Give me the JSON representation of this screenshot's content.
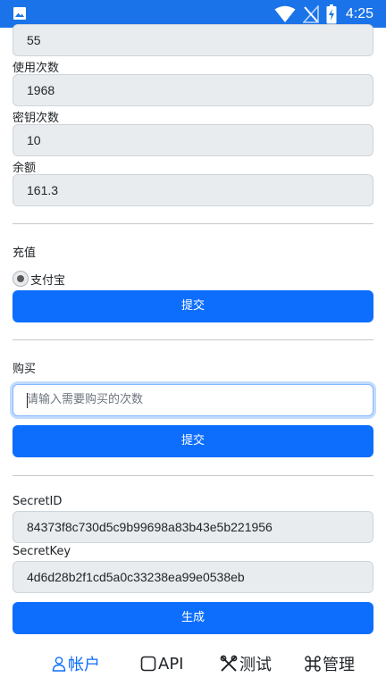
{
  "status_bar": {
    "time": "4:25",
    "icons": [
      "image-icon",
      "wifi-icon",
      "signal-off-icon",
      "battery-charging-icon"
    ]
  },
  "account": {
    "top_value": "55",
    "usage_label": "使用次数",
    "usage_value": "1968",
    "key_count_label": "密钥次数",
    "key_count_value": "10",
    "balance_label": "余额",
    "balance_value": "161.3"
  },
  "recharge": {
    "title": "充值",
    "method_label": "支付宝",
    "submit_label": "提交"
  },
  "purchase": {
    "title": "购买",
    "input_placeholder": "请输入需要购买的次数",
    "submit_label": "提交"
  },
  "keys": {
    "secret_id_label": "SecretID",
    "secret_id_value": "84373f8c730d5c9b99698a83b43e5b221956",
    "secret_key_label": "SecretKey",
    "secret_key_value": "4d6d28b2f1cd5a0c33238ea99e0538eb",
    "generate_label": "生成"
  },
  "tabs": [
    {
      "label": "帐户",
      "icon": "person-icon",
      "active": true
    },
    {
      "label": "API",
      "icon": "square-icon",
      "active": false
    },
    {
      "label": "测试",
      "icon": "tools-icon",
      "active": false
    },
    {
      "label": "管理",
      "icon": "command-icon",
      "active": false
    }
  ],
  "colors": {
    "status_bar": "#1a73e8",
    "primary": "#0d6efd",
    "field_bg": "#e9ecef"
  }
}
